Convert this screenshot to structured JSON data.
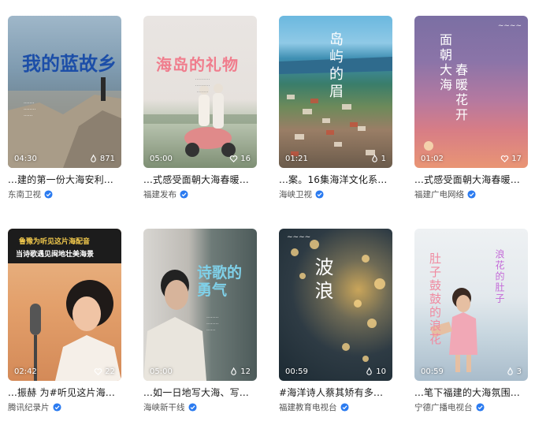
{
  "videos": [
    {
      "duration": "04:30",
      "likes": "871",
      "title": "...建的第一份大海安利...",
      "author": "东南卫视",
      "overlay": {
        "main": "我的蓝故乡"
      }
    },
    {
      "duration": "05:00",
      "likes": "16",
      "title": "...式感受面朝大海春暖...",
      "author": "福建发布",
      "overlay": {
        "main": "海岛的礼物"
      }
    },
    {
      "duration": "01:21",
      "likes": "1",
      "title": "...案。16集海洋文化系...",
      "author": "海峡卫视",
      "overlay": {
        "main": "岛屿的眉"
      }
    },
    {
      "duration": "01:02",
      "likes": "17",
      "title": "...式感受面朝大海春暖...",
      "author": "福建广电网络",
      "overlay": {
        "line1": "面朝大海",
        "line2": "春暖花开"
      }
    },
    {
      "duration": "02:42",
      "likes": "22",
      "title": "...振赫 为#听见这片海...",
      "author": "腾讯纪录片",
      "overlay": {
        "banner1": "鲁豫为听见这片海配音",
        "banner2": "当诗歌遇见闽地壮美海景"
      }
    },
    {
      "duration": "05:00",
      "likes": "12",
      "title": "...如一日地写大海、写...",
      "author": "海峡新干线",
      "overlay": {
        "main": "诗歌的勇气"
      }
    },
    {
      "duration": "00:59",
      "likes": "10",
      "title": "#海洋诗人蔡其矫有多...",
      "author": "福建教育电视台",
      "overlay": {
        "main": "波浪"
      }
    },
    {
      "duration": "00:59",
      "likes": "3",
      "title": "...笔下福建的大海氛围...",
      "author": "宁德广播电视台",
      "overlay": {
        "left": "肚子鼓鼓的浪花",
        "right": "浪花的肚子"
      }
    }
  ],
  "colors": {
    "verify": "#2b7bf0",
    "text": "#1a1a1a",
    "sub": "#555555"
  }
}
